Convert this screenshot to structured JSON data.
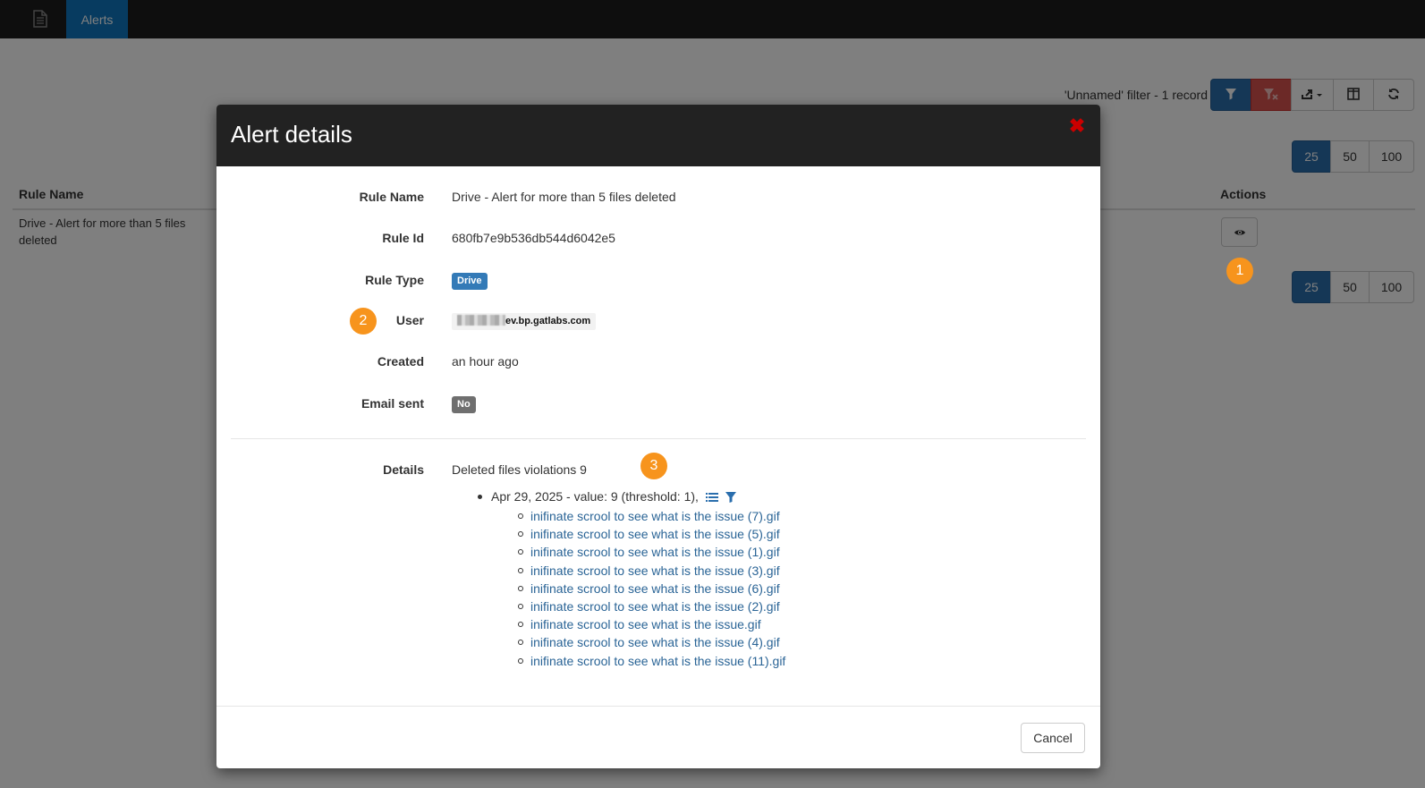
{
  "nav": {
    "active_tab": "Alerts",
    "doc_icon": "document-icon"
  },
  "toolbar": {
    "filter_info": "'Unnamed' filter -  1 record",
    "icons": [
      "filter-icon",
      "clear-filter-icon",
      "export-icon",
      "columns-icon",
      "refresh-icon"
    ]
  },
  "pagination": {
    "options": [
      "25",
      "50",
      "100"
    ],
    "selected": "25"
  },
  "table": {
    "columns": {
      "rule_name": "Rule Name",
      "actions": "Actions"
    },
    "rows": [
      {
        "rule_name": "Drive - Alert for more than 5 files deleted"
      }
    ]
  },
  "callouts": [
    "1",
    "2",
    "3"
  ],
  "modal": {
    "title": "Alert details",
    "close_icon": "close-icon",
    "fields": {
      "rule_name_label": "Rule Name",
      "rule_name_value": "Drive - Alert for more than 5 files deleted",
      "rule_id_label": "Rule Id",
      "rule_id_value": "680fb7e9b536db544d6042e5",
      "rule_type_label": "Rule Type",
      "rule_type_value": "Drive",
      "user_label": "User",
      "user_value": "ev.bp.gatlabs.com",
      "created_label": "Created",
      "created_value": "an hour ago",
      "email_sent_label": "Email sent",
      "email_sent_value": "No",
      "details_label": "Details",
      "details_value": "Deleted files violations 9"
    },
    "violation": {
      "summary": "Apr 29, 2025 - value: 9 (threshold: 1),",
      "files": [
        "inifinate scrool to see what is the issue (7).gif",
        "inifinate scrool to see what is the issue (5).gif",
        "inifinate scrool to see what is the issue (1).gif",
        "inifinate scrool to see what is the issue (3).gif",
        "inifinate scrool to see what is the issue (6).gif",
        "inifinate scrool to see what is the issue (2).gif",
        "inifinate scrool to see what is the issue.gif",
        "inifinate scrool to see what is the issue (4).gif",
        "inifinate scrool to see what is the issue (11).gif"
      ]
    },
    "cancel_label": "Cancel"
  },
  "colors": {
    "navbar": "#1c1c1c",
    "nav_active": "#0e77c0",
    "primary": "#2a6ead",
    "danger": "#d9534f",
    "callout": "#f7941d",
    "link": "#2a6496"
  }
}
